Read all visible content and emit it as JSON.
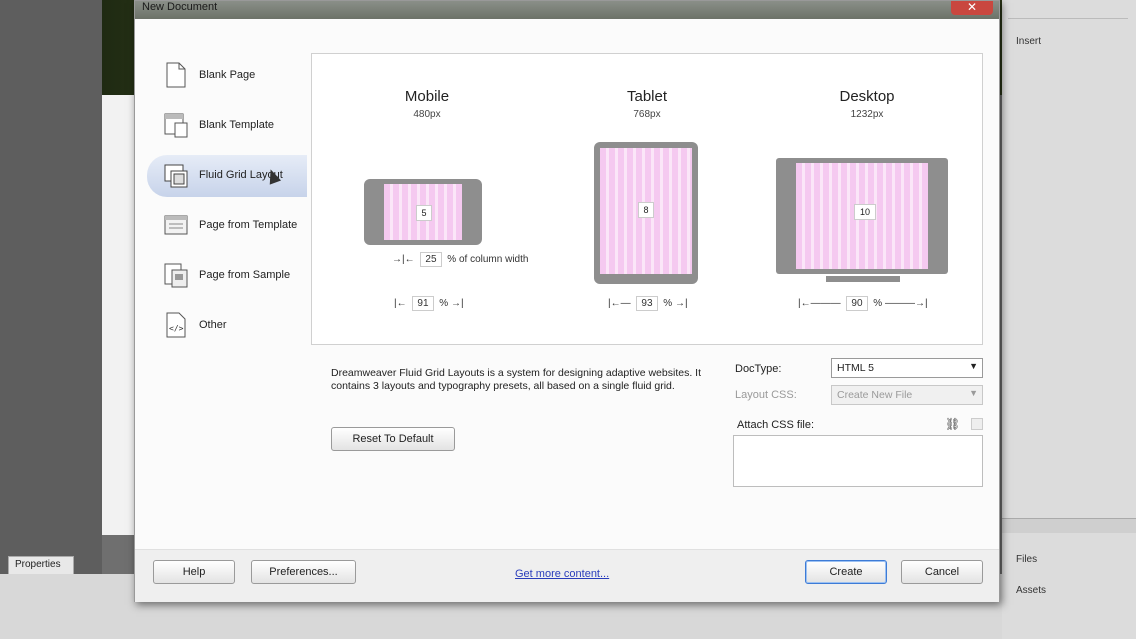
{
  "dialog": {
    "title": "New Document",
    "close_glyph": "✕"
  },
  "background": {
    "insert_label": "Insert",
    "files_label": "Files",
    "assets_label": "Assets",
    "properties_tab": "Properties"
  },
  "sidebar": {
    "items": [
      {
        "label": "Blank Page",
        "icon": "blank-page-icon"
      },
      {
        "label": "Blank Template",
        "icon": "blank-template-icon"
      },
      {
        "label": "Fluid Grid Layout",
        "icon": "fluid-grid-icon",
        "selected": true
      },
      {
        "label": "Page from Template",
        "icon": "page-from-template-icon"
      },
      {
        "label": "Page from Sample",
        "icon": "page-from-sample-icon"
      },
      {
        "label": "Other",
        "icon": "code-file-icon"
      }
    ]
  },
  "layouts": {
    "mobile": {
      "title": "Mobile",
      "size": "480px",
      "columns": "5",
      "column_width_pct": "25",
      "column_width_label": "% of column width",
      "width_pct": "91",
      "pct_sign": "%"
    },
    "tablet": {
      "title": "Tablet",
      "size": "768px",
      "columns": "8",
      "width_pct": "93",
      "pct_sign": "%"
    },
    "desktop": {
      "title": "Desktop",
      "size": "1232px",
      "columns": "10",
      "width_pct": "90",
      "pct_sign": "%"
    }
  },
  "description": "Dreamweaver Fluid Grid Layouts is a system for designing adaptive websites. It contains 3 layouts and typography presets, all based on a single fluid grid.",
  "buttons": {
    "reset": "Reset To Default",
    "help": "Help",
    "preferences": "Preferences...",
    "create": "Create",
    "cancel": "Cancel"
  },
  "options": {
    "doctype_label": "DocType:",
    "doctype_value": "HTML 5",
    "layout_css_label": "Layout CSS:",
    "layout_css_value": "Create New File",
    "attach_css_label": "Attach CSS file:"
  },
  "footer": {
    "get_more_content": "Get more content..."
  }
}
